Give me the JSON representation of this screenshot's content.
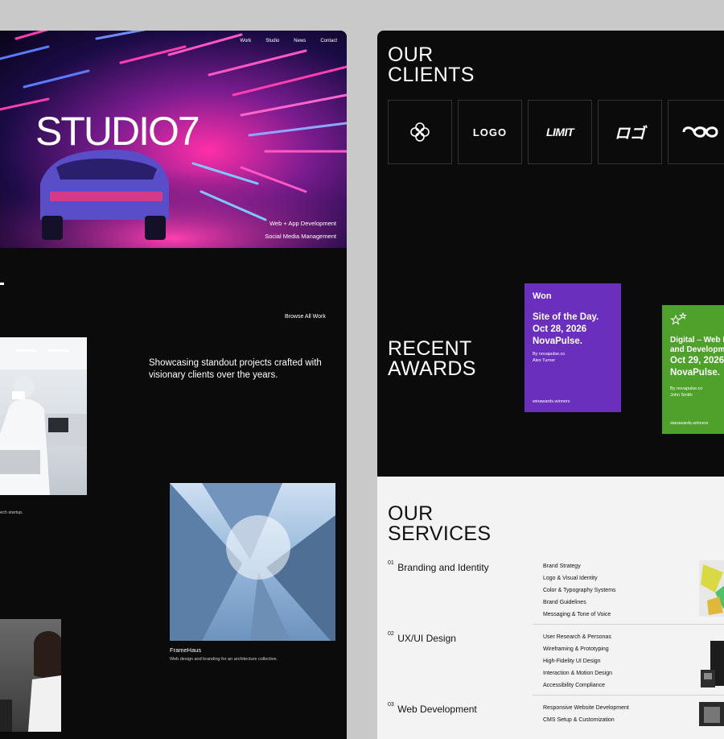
{
  "left": {
    "nav": [
      "Work",
      "Studio",
      "News",
      "Contact"
    ],
    "brand": "STUDIO7",
    "hero_services": [
      "Web + App Development",
      "Social Media Management"
    ],
    "browse": "Browse All Work",
    "showcase": "Showcasing standout projects crafted with visionary clients over the years.",
    "project1_caption": "ech startup.",
    "project2": {
      "title": "FrameHaus",
      "desc": "Web design and branding for an architecture collective."
    }
  },
  "right": {
    "clients_heading": [
      "OUR",
      "CLIENTS"
    ],
    "client_logos": [
      "flower-logo-icon",
      "LOGO",
      "LIMIT",
      "ロゴ",
      "infinity-logo-icon"
    ],
    "awards_heading": [
      "RECENT",
      "AWARDS"
    ],
    "awards": [
      {
        "badge": "Won",
        "title": [
          "Site of the Day.",
          "Oct 28, 2026",
          "NovaPulse."
        ],
        "by": [
          "By novapulse.co",
          "Alex Turner"
        ],
        "footer": "winawards.winners",
        "color": "#6b2fbd"
      },
      {
        "badge": "",
        "title": [
          "Digital – Web D",
          "and Developm",
          "Oct 29, 2026",
          "NovaPulse."
        ],
        "by": [
          "By novapulse.co",
          "John Smith"
        ],
        "footer": "starawards.winners",
        "color": "#4ea12a"
      }
    ],
    "services_heading": [
      "OUR",
      "SERVICES"
    ],
    "services": [
      {
        "num": "01",
        "name": "Branding and Identity",
        "items": [
          "Brand Strategy",
          "Logo & Visual Identity",
          "Color & Typography Systems",
          "Brand Guidelines",
          "Messaging & Tone of Voice"
        ]
      },
      {
        "num": "02",
        "name": "UX/UI Design",
        "items": [
          "User Research & Personas",
          "Wireframing & Prototyping",
          "High-Fidelity UI Design",
          "Interaction & Motion Design",
          "Accessibility Compliance"
        ]
      },
      {
        "num": "03",
        "name": "Web Development",
        "items": [
          "Responsive Website Development",
          "CMS Setup & Customization"
        ]
      }
    ]
  }
}
